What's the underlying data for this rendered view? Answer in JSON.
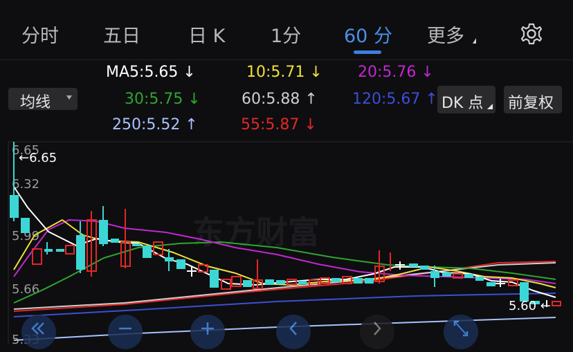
{
  "tabs": [
    {
      "label": "分时"
    },
    {
      "label": "五日"
    },
    {
      "label": "日 K"
    },
    {
      "label": "1分"
    },
    {
      "label": "60 分"
    },
    {
      "label": "更多"
    }
  ],
  "ma": {
    "ma5": "MA5:5.65 ↓",
    "ma10": "10:5.71 ↓",
    "ma20": "20:5.76 ↓",
    "ma30": "30:5.75 ↓",
    "ma60": "60:5.88 ↑",
    "ma120": "120:5.67 ↑",
    "ma250": "250:5.52 ↑",
    "ma55": "55:5.87 ↓"
  },
  "buttons": {
    "junxian": "均线",
    "dk": "DK 点",
    "fuquan": "前复权"
  },
  "axis": {
    "y1": "6.65",
    "y2": "6.32",
    "y3": "5.99",
    "y4": "5.66",
    "y5": "5.33"
  },
  "labels": {
    "high": "←6.65",
    "low": "5.60 ←"
  },
  "watermark": "东方财富",
  "colors": {
    "active": "#4a8fe7",
    "ma5": "#ffffff",
    "ma10": "#f0e03a",
    "ma20": "#c228d0",
    "ma30": "#2fa62f",
    "ma60": "#cfcfcf",
    "ma120": "#3b4fd8",
    "ma250": "#a8c2ff",
    "ma55": "#e42727",
    "up": "#e42727",
    "down": "#3cd6d6"
  }
}
